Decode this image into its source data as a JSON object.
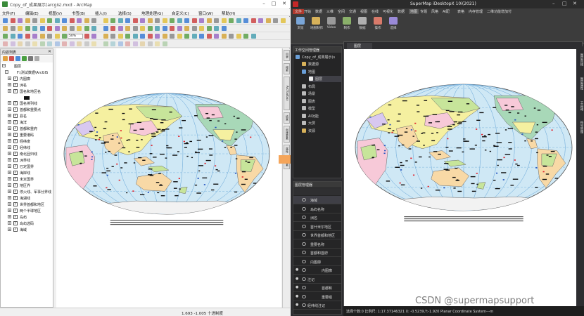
{
  "arcmap": {
    "title": "Copy_of_成果展示(arcgis).mxd - ArcMap",
    "menu": [
      "文件(F)",
      "编辑(E)",
      "视图(V)",
      "书签(B)",
      "插入(I)",
      "选择(S)",
      "地理处理(G)",
      "自定义(C)",
      "窗口(W)",
      "帮助(H)"
    ],
    "scale_value": "50%",
    "toc": {
      "title": "内容列表",
      "root_label": "图层",
      "group_label": "F:\\测试数据\\ArcGIS",
      "items": [
        "内图廓",
        "洲名",
        "国名和地区名",
        "国名排列线",
        "首都和重要点",
        "县名",
        "海洋",
        "首都和重府",
        "重要港码",
        "经纬度",
        "经纬线",
        "南北回归线",
        "洲界线",
        "已定国界",
        "海岸线",
        "未定国界",
        "地区界",
        "停火线、军事分界线",
        "海湖线",
        "世界首都和地区",
        "两个半球地区",
        "岛屿",
        "岛屿选码",
        "海域"
      ]
    },
    "side_tabs": [
      "目录",
      "搜索",
      "ArcToolbox",
      "结果",
      "创建要素",
      "属性",
      "要素"
    ],
    "status": "1.693  -1.005 十进制度"
  },
  "supermap": {
    "title": "SuperMap iDesktopX 10i(2021)",
    "tabs": [
      "文件",
      "开始",
      "数据",
      "三维",
      "空间",
      "交通",
      "视图",
      "在线",
      "可视化",
      "数据",
      "地图",
      "专题",
      "风格",
      "AI配",
      "表格",
      "内存管理",
      "二维功能增加付"
    ],
    "ribbon": [
      "浏览",
      "地图制作",
      "Video",
      "制作",
      "数据",
      "操作",
      "选择"
    ],
    "workspace": {
      "title": "工作空间管理器",
      "root": "Copy_of_成果展示(s",
      "items": [
        "数据源",
        "地图",
        "图层",
        "布局",
        "场景",
        "图表",
        "模型",
        "AI功能",
        "大屏",
        "资源"
      ]
    },
    "layers": {
      "title": "图层管理器",
      "items": [
        "海域",
        "岛屿名称",
        "洲名",
        "首什米尔地区",
        "世界首都和地区",
        "重要名称",
        "首都和首府",
        "内图廓",
        "内图廓",
        "注记",
        "首都和",
        "重要组",
        "经纬线注记"
      ]
    },
    "doc_tab": "图层",
    "right_tabs": [
      "图层风格",
      "图层属性",
      "工具箱",
      "符号管理"
    ],
    "status": "选择个数:0  比例尺: 1:17.37146321    X: -0.5239,Y:-1.920  Planar Coordinate System---m"
  },
  "watermark": "CSDN @supermapsupport",
  "colors": {
    "ocean": "#cfe8f5",
    "antarctica": "#f2f2f2",
    "land_colors": [
      "#f5f0a0",
      "#f7c9d8",
      "#c7e59a",
      "#f8d9a6",
      "#d8c8f0",
      "#a8d8b8"
    ],
    "arrow": "#f5a55a",
    "grid": "#6aa8d8"
  }
}
